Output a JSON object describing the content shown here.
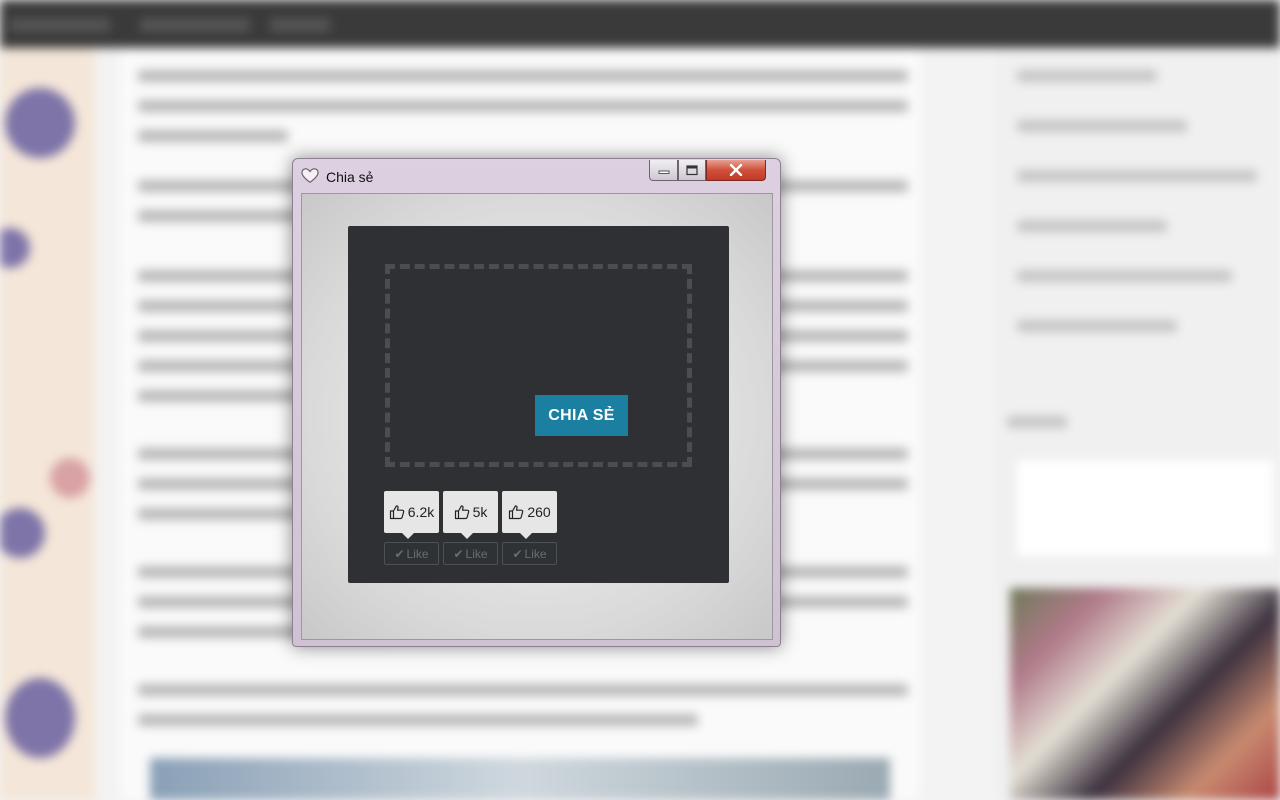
{
  "window": {
    "title": "Chia sẻ",
    "minimize_glyph": "—",
    "maximize_glyph": "☐",
    "close_glyph": "✕"
  },
  "widget": {
    "share_button_label": "CHIA SẺ",
    "like_label": "Like",
    "counts": [
      {
        "count": "6.2k"
      },
      {
        "count": "5k"
      },
      {
        "count": "260"
      }
    ]
  },
  "colors": {
    "share_button": "#1a7fa0",
    "panel": "#2e3033",
    "close_button": "#c23a26"
  },
  "icons": {
    "window": "heart-icon",
    "count": "thumbs-up-icon",
    "like": "check-icon"
  }
}
